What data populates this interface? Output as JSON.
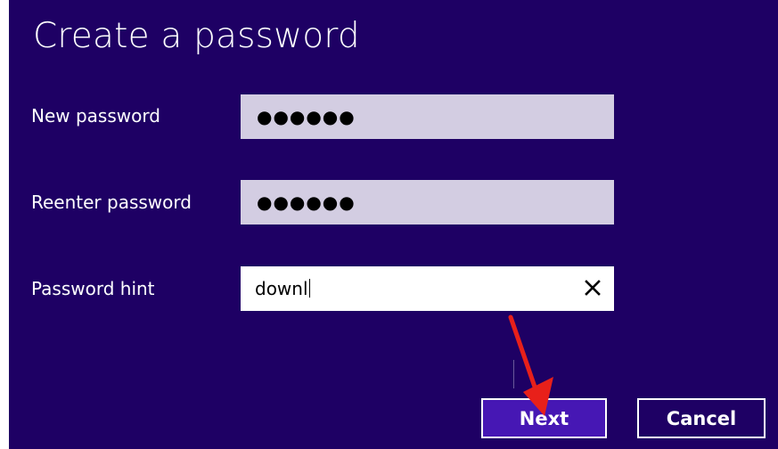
{
  "dialog": {
    "title": "Create a password"
  },
  "fields": {
    "new_password": {
      "label": "New password",
      "masked_value": "●●●●●●"
    },
    "reenter_password": {
      "label": "Reenter password",
      "masked_value": "●●●●●●"
    },
    "password_hint": {
      "label": "Password hint",
      "value": "downl",
      "clear_icon": "close-icon"
    }
  },
  "buttons": {
    "next_label": "Next",
    "cancel_label": "Cancel"
  },
  "colors": {
    "background": "#1e0064",
    "masked_field": "#d3cde2",
    "next_button": "#4617b4",
    "annotation_arrow": "#e8201a"
  }
}
